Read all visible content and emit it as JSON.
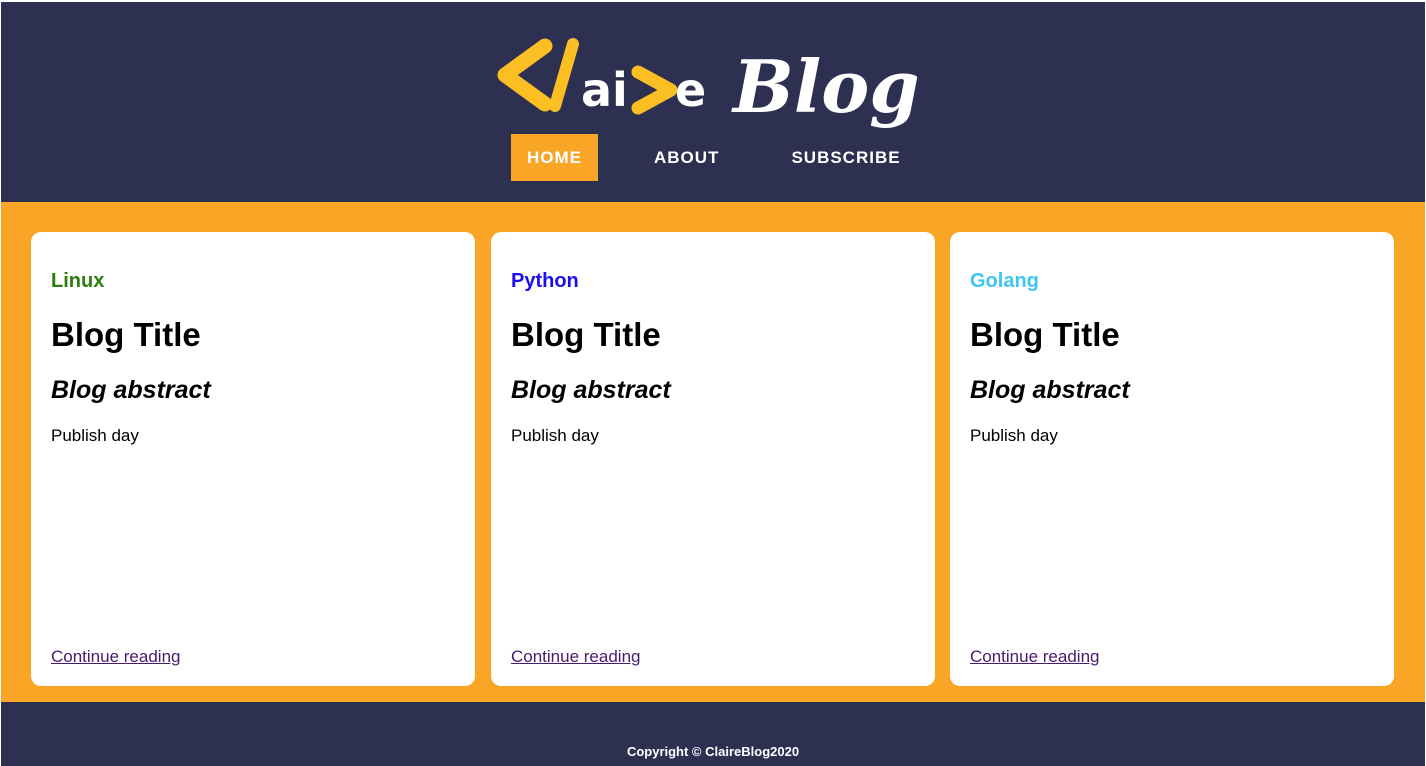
{
  "colors": {
    "header_bg": "#2e3052",
    "accent": "#f9a526",
    "card_bg": "#ffffff",
    "link": "#4a1a6e"
  },
  "logo": {
    "text": "</aire Blog",
    "bracket_color": "#fbbf24"
  },
  "nav": {
    "items": [
      {
        "label": "HOME",
        "active": true
      },
      {
        "label": "ABOUT",
        "active": false
      },
      {
        "label": "SUBSCRIBE",
        "active": false
      }
    ]
  },
  "posts": [
    {
      "category": "Linux",
      "category_color": "#2e7d0e",
      "title": "Blog Title",
      "abstract": "Blog abstract",
      "publish": "Publish day",
      "link": "Continue reading"
    },
    {
      "category": "Python",
      "category_color": "#1a0ff0",
      "title": "Blog Title",
      "abstract": "Blog abstract",
      "publish": "Publish day",
      "link": "Continue reading"
    },
    {
      "category": "Golang",
      "category_color": "#3ec5f5",
      "title": "Blog Title",
      "abstract": "Blog abstract",
      "publish": "Publish day",
      "link": "Continue reading"
    }
  ],
  "footer": {
    "copyright": "Copyright © ClaireBlog2020"
  }
}
